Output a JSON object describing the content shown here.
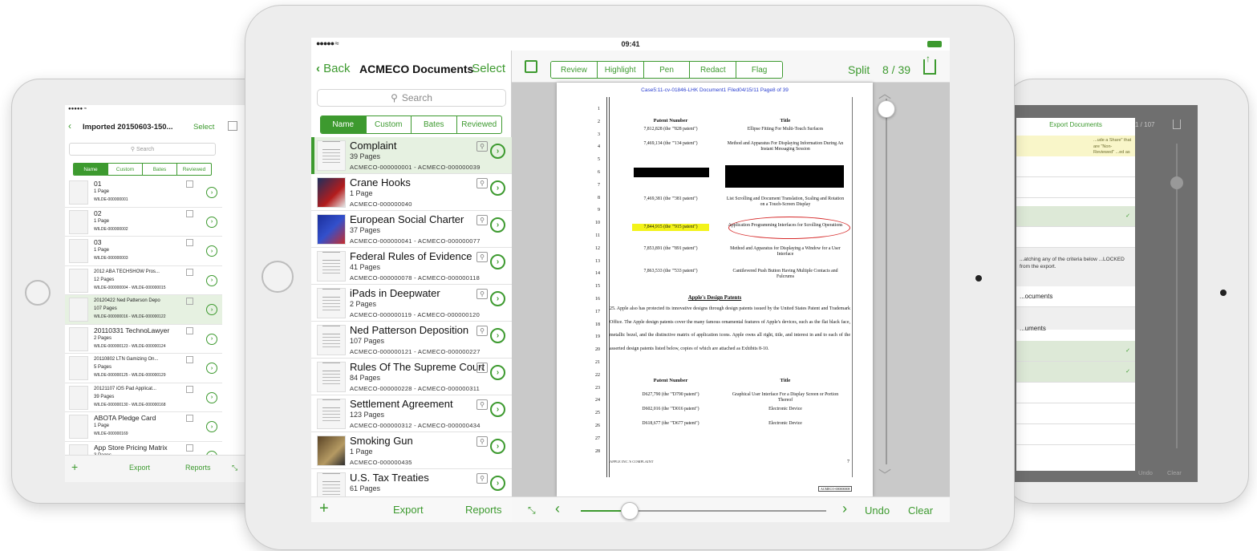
{
  "main": {
    "status": {
      "signal": "●●●●● ≈",
      "time": "09:41"
    },
    "nav": {
      "back": "Back",
      "title": "ACMECO Documents",
      "select": "Select"
    },
    "search_placeholder": "Search",
    "sort_tabs": [
      "Name",
      "Custom",
      "Bates",
      "Reviewed"
    ],
    "documents": [
      {
        "title": "Complaint",
        "pages": "39 Pages",
        "bates": "ACMECO-000000001 - ACMECO-000000039",
        "thumb": "doc"
      },
      {
        "title": "Crane Hooks",
        "pages": "1 Page",
        "bates": "ACMECO-000000040",
        "thumb": "photo-red"
      },
      {
        "title": "European Social Charter",
        "pages": "37 Pages",
        "bates": "ACMECO-000000041 - ACMECO-000000077",
        "thumb": "photo-blue"
      },
      {
        "title": "Federal Rules of Evidence",
        "pages": "41 Pages",
        "bates": "ACMECO-000000078 - ACMECO-000000118",
        "thumb": "doc"
      },
      {
        "title": "iPads in Deepwater",
        "pages": "2 Pages",
        "bates": "ACMECO-000000119 - ACMECO-000000120",
        "thumb": "doc"
      },
      {
        "title": "Ned Patterson Deposition",
        "pages": "107 Pages",
        "bates": "ACMECO-000000121 - ACMECO-000000227",
        "thumb": "doc"
      },
      {
        "title": "Rules Of The Supreme Court",
        "pages": "84 Pages",
        "bates": "ACMECO-000000228 - ACMECO-000000311",
        "thumb": "doc"
      },
      {
        "title": "Settlement Agreement",
        "pages": "123 Pages",
        "bates": "ACMECO-000000312 - ACMECO-000000434",
        "thumb": "doc"
      },
      {
        "title": "Smoking Gun",
        "pages": "1 Page",
        "bates": "ACMECO-000000435",
        "thumb": "photo-brown"
      },
      {
        "title": "U.S. Tax Treaties",
        "pages": "61 Pages",
        "bates": "",
        "thumb": "doc"
      }
    ],
    "left_toolbar": {
      "add": "+",
      "export": "Export",
      "reports": "Reports"
    },
    "annotation_tools": [
      "Review",
      "Highlight",
      "Pen",
      "Redact",
      "Flag"
    ],
    "split": "Split",
    "page_indicator": "8 / 39",
    "bottom_bar": {
      "undo": "Undo",
      "clear": "Clear"
    },
    "page_slider_value": 0.2,
    "page_doc": {
      "header": "Case5:11-cv-01846-LHK   Document1   Filed04/15/11   Page8 of 39",
      "line_numbers": [
        "1",
        "2",
        "3",
        "4",
        "5",
        "6",
        "7",
        "8",
        "9",
        "10",
        "11",
        "12",
        "13",
        "14",
        "15",
        "16",
        "17",
        "18",
        "19",
        "20",
        "21",
        "22",
        "23",
        "24",
        "25",
        "26",
        "27",
        "28"
      ],
      "col_patent": "Patent Number",
      "col_title": "Title",
      "patents": [
        {
          "num": "7,812,828 (the \"'828 patent\")",
          "title": "Ellipse Fitting For Multi-Touch Surfaces"
        },
        {
          "num": "7,469,134 (the \"'134 patent\")",
          "title": "Method and Apparatus For Displaying Information During An Instant Messaging Session"
        },
        {
          "num": "7,469,381 (the \"'381 patent\")",
          "title": "List Scrolling and Document Translation, Scaling and Rotation on a Touch-Screen Display"
        },
        {
          "num": "7,844,915 (the \"'915 patent\")",
          "title": "Application Programming Interfaces for Scrolling Operations"
        },
        {
          "num": "7,853,891 (the \"'891 patent\")",
          "title": "Method and Apparatus for Displaying a Window for a User Interface"
        },
        {
          "num": "7,863,533 (the \"'533 patent\")",
          "title": "Cantilevered Push Button Having Multiple Contacts and Fulcrums"
        }
      ],
      "design_heading": "Apple's Design Patents",
      "paragraph": "25.     Apple also has protected its innovative designs through design patents issued by the United States Patent and Trademark Office. The Apple design patents cover the many famous ornamental features of Apple's devices, such as the flat black face, metallic bezel, and the distinctive matrix of application icons. Apple owns all right, title, and interest in and to each of the asserted design patents listed below, copies of which are attached as Exhibits 8-10.",
      "design_patents": [
        {
          "num": "D627,790 (the \"'D790 patent\")",
          "title": "Graphical User Interface For a Display Screen or Portion Thereof"
        },
        {
          "num": "D602,016 (the \"'D016 patent\")",
          "title": "Electronic Device"
        },
        {
          "num": "D618,677 (the \"'D677 patent\")",
          "title": "Electronic Device"
        }
      ],
      "footer": "APPLE INC.'S COMPLAINT",
      "footer_num": "7",
      "bates_stamp": "ACMECO-000000008"
    }
  },
  "left_device": {
    "status": "●●●●● ≈",
    "nav": {
      "back": "‹",
      "title": "Imported 20150603-150...",
      "select": "Select"
    },
    "search_placeholder": "Search",
    "sort_tabs": [
      "Name",
      "Custom",
      "Bates",
      "Reviewed"
    ],
    "documents": [
      {
        "title": "01",
        "pages": "1 Page",
        "bates": "WILDE-000000001",
        "small": false
      },
      {
        "title": "02",
        "pages": "1 Page",
        "bates": "WILDE-000000002",
        "small": false
      },
      {
        "title": "03",
        "pages": "1 Page",
        "bates": "WILDE-000000003",
        "small": false
      },
      {
        "title": "2012 ABA TECHSHOW Pros...",
        "pages": "12 Pages",
        "bates": "WILDE-000000004 - WILDE-000000015",
        "small": true
      },
      {
        "title": "20120422 Ned Patterson Depo",
        "pages": "107 Pages",
        "bates": "WILDE-000000016 - WILDE-000000122",
        "small": true
      },
      {
        "title": "20110331 TechnoLawyer",
        "pages": "2 Pages",
        "bates": "WILDE-000000123 - WILDE-000000124",
        "small": false
      },
      {
        "title": "20110802 LTN Gamizing On...",
        "pages": "5 Pages",
        "bates": "WILDE-000000125 - WILDE-000000129",
        "small": true
      },
      {
        "title": "20121107 iOS Pad Applicat...",
        "pages": "39 Pages",
        "bates": "WILDE-000000130 - WILDE-000000168",
        "small": true
      },
      {
        "title": "ABOTA Pledge Card",
        "pages": "1 Page",
        "bates": "WILDE-000000169",
        "small": false
      },
      {
        "title": "App Store Pricing Matrix",
        "pages": "3 Pages",
        "bates": "",
        "small": false
      }
    ],
    "toolbar": {
      "add": "+",
      "export": "Export",
      "reports": "Reports"
    }
  },
  "right_device": {
    "sheet_title": "Export Documents",
    "note": "...ude a Share\" that are \"Non-Reviewed\" ...ed as \"Confidential\" or \"Privileged\"",
    "criteria_text": "...atching any of the criteria below ...LOCKED from the export.",
    "row_documents_1": "...ocuments",
    "row_documents_2": "...uments",
    "page_counter": "1 / 107",
    "bottom": {
      "undo": "Undo",
      "clear": "Clear"
    },
    "tick": "✓"
  }
}
